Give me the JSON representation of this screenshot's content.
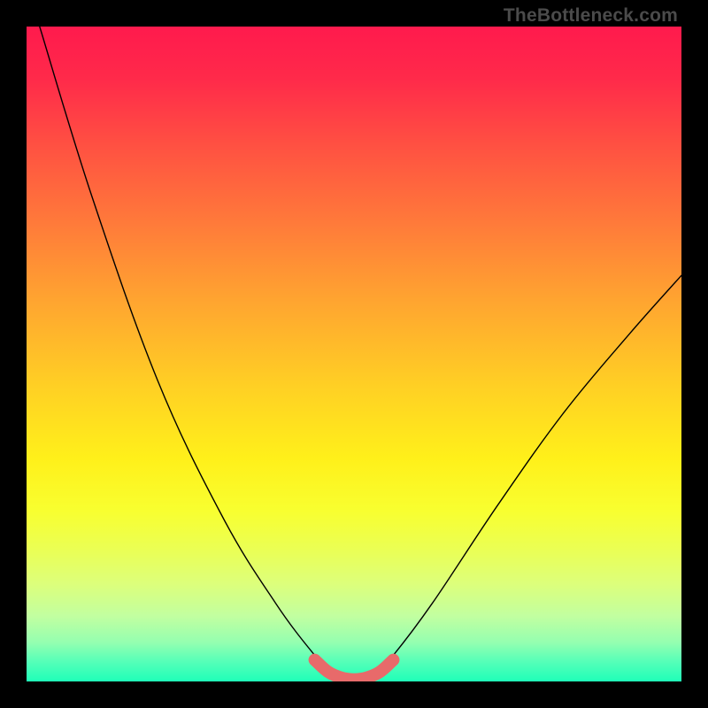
{
  "watermark": "TheBottleneck.com",
  "chart_data": {
    "type": "line",
    "title": "",
    "xlabel": "",
    "ylabel": "",
    "xlim": [
      0,
      1
    ],
    "ylim": [
      0,
      1
    ],
    "series": [
      {
        "name": "black-curve",
        "color": "#000000",
        "x": [
          0.02,
          0.1,
          0.2,
          0.3,
          0.38,
          0.44,
          0.47,
          0.5,
          0.53,
          0.56,
          0.62,
          0.72,
          0.82,
          0.92,
          1.0
        ],
        "y": [
          1.0,
          0.74,
          0.46,
          0.25,
          0.12,
          0.04,
          0.01,
          0.0,
          0.01,
          0.04,
          0.12,
          0.27,
          0.41,
          0.53,
          0.62
        ]
      },
      {
        "name": "coral-trough",
        "color": "#e86a6a",
        "x": [
          0.44,
          0.46,
          0.48,
          0.5,
          0.52,
          0.54,
          0.56
        ],
        "y": [
          0.033,
          0.015,
          0.006,
          0.003,
          0.006,
          0.015,
          0.033
        ]
      }
    ],
    "background": "rainbow-vertical-gradient",
    "annotations": []
  }
}
